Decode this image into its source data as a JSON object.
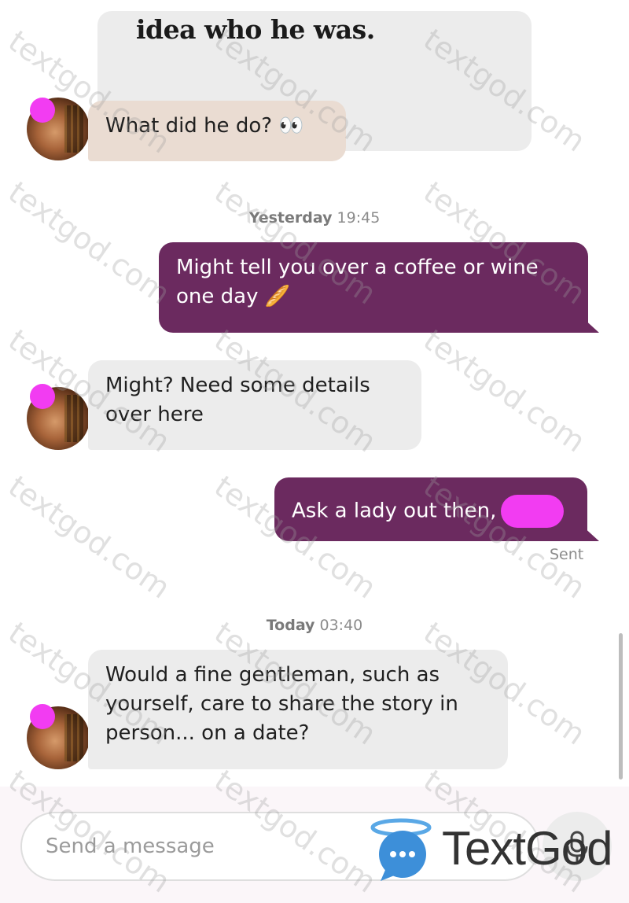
{
  "conversation": {
    "quote_fragment": "idea who he was.",
    "messages": [
      {
        "side": "in",
        "text": "What did he do? 👀"
      },
      {
        "side": "out",
        "text": "Might tell you over a coffee or wine one day 🥖"
      },
      {
        "side": "in",
        "text": "Might? Need some details over here"
      },
      {
        "side": "out",
        "text": "Ask a lady out then,"
      },
      {
        "side": "in",
        "text": "Would a fine gentleman, such as yourself, care to share the story in person... on a date?"
      }
    ],
    "stamp_yesterday_day": "Yesterday",
    "stamp_yesterday_time": "19:45",
    "sent_label": "Sent",
    "stamp_today_day": "Today",
    "stamp_today_time": "03:40"
  },
  "composer": {
    "placeholder": "Send a message",
    "mic_icon": "microphone-icon"
  },
  "watermark": {
    "text": "textgod.com",
    "logo_text": "TextGod",
    "logo_icon": "chat-bubble-halo-icon"
  },
  "colors": {
    "outgoing_bubble": "#6b2a5f",
    "incoming_bubble": "#ececec",
    "redaction": "#f23cf2"
  }
}
